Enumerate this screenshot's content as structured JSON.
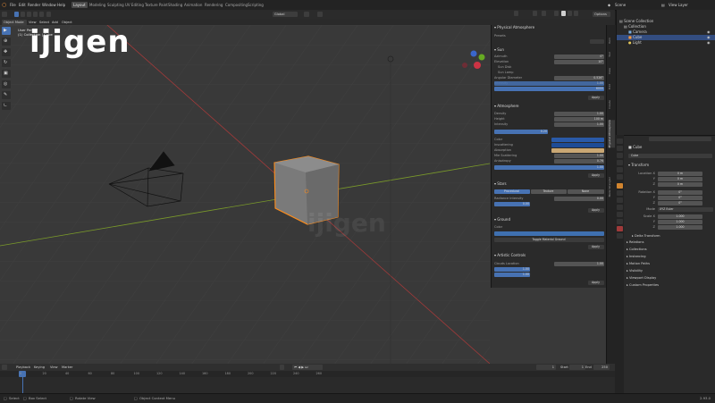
{
  "menu": [
    "File",
    "Edit",
    "Render",
    "Window",
    "Help"
  ],
  "workspaces": [
    "Layout",
    "Modeling",
    "Sculpting",
    "UV Editing",
    "Texture Paint",
    "Shading",
    "Animation",
    "Rendering",
    "Compositing",
    "Scripting"
  ],
  "active_workspace": "Layout",
  "scene": "Scene",
  "view_layer": "View Layer",
  "header": {
    "mode": "Object Mode",
    "menus": [
      "View",
      "Select",
      "Add",
      "Object"
    ],
    "transform": "Global",
    "options": "Options"
  },
  "viewport": {
    "info_line1": "User Persp",
    "info_line2": "(1) Collection | Cube",
    "logo": "ijigen",
    "watermark": "ijigen"
  },
  "physical_atmosphere": {
    "title": "Physical Atmosphere",
    "preset_label": "Presets",
    "sun": {
      "title": "Sun",
      "fields": [
        {
          "label": "Azimuth",
          "value": "0°"
        },
        {
          "label": "Elevation",
          "value": "10°"
        },
        {
          "label": "Sun Disk",
          "value": ""
        },
        {
          "label": "Sun Lamp",
          "value": ""
        },
        {
          "label": "Angular Diameter",
          "value": "0.526°"
        },
        {
          "label": "Intensity",
          "value": "1.00"
        },
        {
          "label": "Temperature",
          "value": "6000"
        }
      ],
      "apply": "Apply"
    },
    "atmosphere": {
      "title": "Atmosphere",
      "fields": [
        {
          "label": "Density",
          "value": "1.00"
        },
        {
          "label": "Height",
          "value": "100 m"
        },
        {
          "label": "Intensity",
          "value": "1.00"
        },
        {
          "label": "Night Intensity",
          "value": "0.20"
        },
        {
          "label": "Color",
          "value": ""
        },
        {
          "label": "Inscattering",
          "value": ""
        },
        {
          "label": "Absorption",
          "value": ""
        },
        {
          "label": "Mie Scattering",
          "value": "1.00"
        },
        {
          "label": "Anisotropy",
          "value": "0.76"
        },
        {
          "label": "Exposure",
          "value": "1.00"
        }
      ],
      "apply": "Apply"
    },
    "stars": {
      "title": "Stars",
      "tabs": [
        "Procedural",
        "Texture",
        "None"
      ],
      "fields": [
        {
          "label": "Radiance Intensity",
          "value": "0.00"
        },
        {
          "label": "Amount",
          "value": "0.00"
        }
      ],
      "apply": "Apply"
    },
    "ground": {
      "title": "Ground",
      "color_label": "Color",
      "toggle": "Toggle Material Ground",
      "apply": "Apply"
    },
    "artistic": {
      "title": "Artistic Controls",
      "fields": [
        {
          "label": "Clouds Location",
          "value": "1.00"
        },
        {
          "label": "Sunset",
          "value": "1.00"
        },
        {
          "label": "Atmosphere Scattering",
          "value": "1.00"
        }
      ],
      "apply": "Apply"
    }
  },
  "vertical_tabs": [
    "Item",
    "Tool",
    "View",
    "Edit",
    "Create",
    "Physical Atmosphere",
    "Node Wrangler"
  ],
  "outliner": {
    "items": [
      {
        "label": "Scene Collection",
        "selected": false
      },
      {
        "label": "Collection",
        "selected": false
      },
      {
        "label": "Camera",
        "selected": false
      },
      {
        "label": "Cube",
        "selected": true
      },
      {
        "label": "Light",
        "selected": false
      }
    ]
  },
  "properties": {
    "breadcrumb": "Cube",
    "name": "Cube",
    "transform_title": "Transform",
    "location_label": "Location X",
    "location": [
      "0 m",
      "0 m",
      "0 m"
    ],
    "rotation_label": "Rotation X",
    "rotation": [
      "0°",
      "0°",
      "0°"
    ],
    "mode_label": "Mode",
    "mode": "XYZ Euler",
    "scale_label": "Scale X",
    "scale": [
      "1.000",
      "1.000",
      "1.000"
    ],
    "axis_labels": [
      "Y",
      "Z"
    ],
    "sections": [
      "Delta Transform",
      "Relations",
      "Collections",
      "Instancing",
      "Motion Paths",
      "Visibility",
      "Viewport Display",
      "Custom Properties"
    ]
  },
  "timeline": {
    "menus": [
      "Playback",
      "Keying",
      "View",
      "Marker"
    ],
    "current_frame": "1",
    "start_label": "Start",
    "start": "1",
    "end_label": "End",
    "end": "250",
    "ticks": [
      "0",
      "20",
      "40",
      "60",
      "80",
      "100",
      "120",
      "140",
      "160",
      "180",
      "200",
      "220",
      "240",
      "260"
    ]
  },
  "status": {
    "select": "Select",
    "box_select": "Box Select",
    "rotate_view": "Rotate View",
    "context_menu": "Object Context Menu",
    "version": "2.93.0"
  }
}
